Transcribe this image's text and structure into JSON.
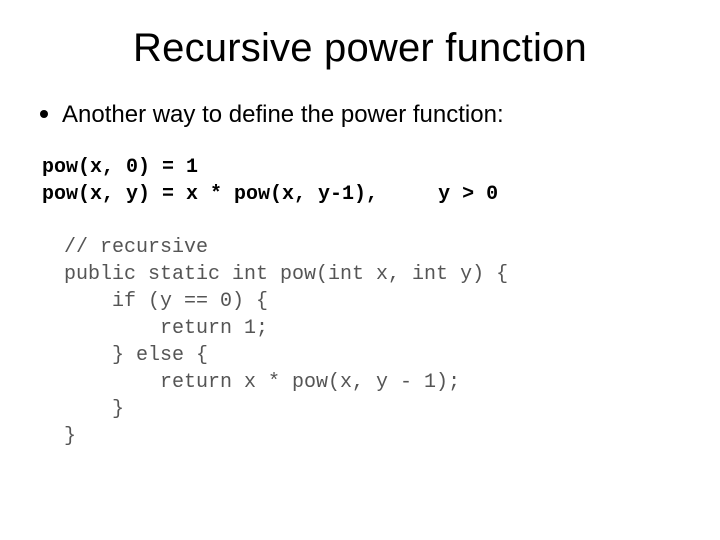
{
  "title": "Recursive power function",
  "bullet": "Another way to define the power function:",
  "definition": "pow(x, 0) = 1\npow(x, y) = x * pow(x, y-1),     y > 0",
  "code": "// recursive\npublic static int pow(int x, int y) {\n    if (y == 0) {\n        return 1;\n    } else {\n        return x * pow(x, y - 1);\n    }\n}"
}
